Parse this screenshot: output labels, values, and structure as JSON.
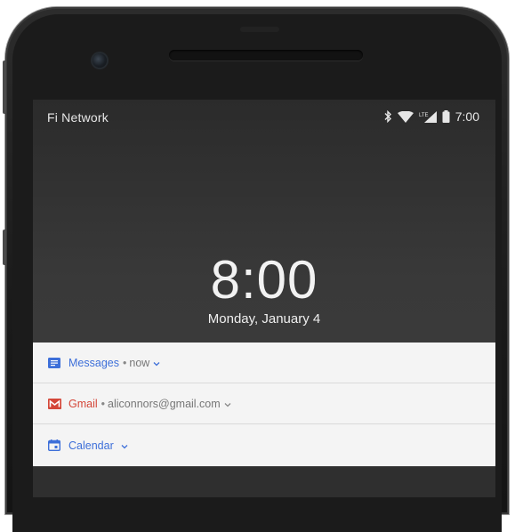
{
  "status_bar": {
    "carrier": "Fi Network",
    "time": "7:00",
    "icons": [
      "bluetooth-icon",
      "wifi-icon",
      "lte-signal-icon",
      "battery-icon"
    ]
  },
  "lock_screen": {
    "clock": "8:00",
    "date": "Monday, January 4"
  },
  "notifications": [
    {
      "app": "Messages",
      "detail": "now",
      "color": "#3d6fd9",
      "icon": "messages-icon"
    },
    {
      "app": "Gmail",
      "detail": "aliconnors@gmail.com",
      "color": "#d44638",
      "icon": "gmail-icon"
    },
    {
      "app": "Calendar",
      "detail": "",
      "color": "#3d6fd9",
      "icon": "calendar-icon"
    }
  ]
}
